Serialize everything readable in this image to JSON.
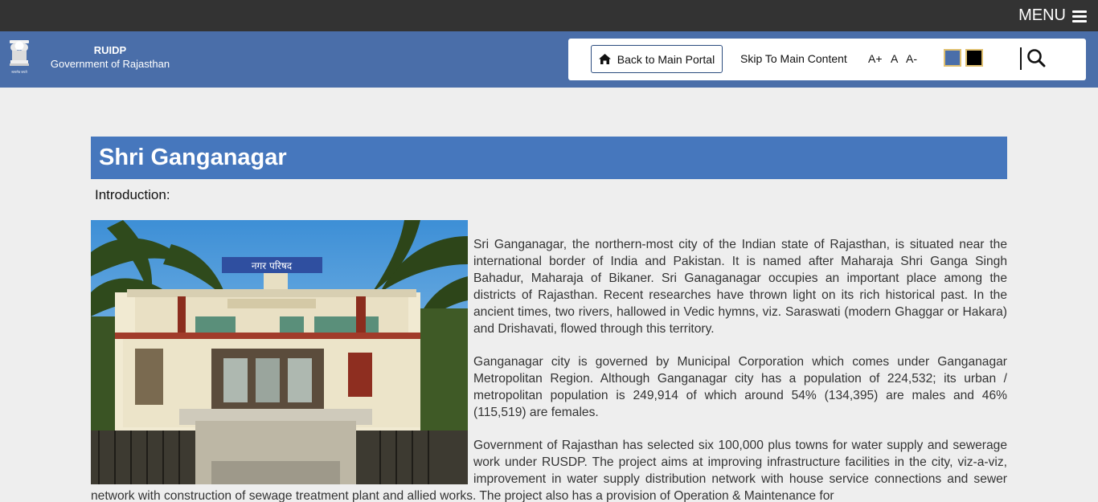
{
  "topbar": {
    "menu_label": "MENU"
  },
  "header": {
    "brand_name": "RUIDP",
    "brand_subtitle": "Government of Rajasthan",
    "emblem_text": "सत्यमेव जयते"
  },
  "toolbar": {
    "back_label": "Back to Main Portal",
    "skip_label": "Skip To Main Content",
    "font_increase": "A+",
    "font_normal": "A",
    "font_decrease": "A-"
  },
  "colors": {
    "header_blue": "#4a6ea9",
    "title_blue": "#4677bd",
    "topbar": "#333333"
  },
  "page": {
    "title": "Shri Ganganagar",
    "intro_heading": "Introduction:",
    "photo_sign_text": "नगर परिषद",
    "paragraphs": [
      "Sri Ganganagar, the northern-most city of the Indian state of Rajasthan, is situated near the international border of India and Pakistan. It is named after Maharaja Shri Ganga Singh Bahadur, Maharaja of Bikaner. Sri Ganaganagar occupies an important place among the districts of Rajasthan. Recent researches have thrown light on its rich historical past. In the ancient times, two rivers, hallowed in Vedic hymns, viz. Saraswati (modern Ghaggar or Hakara) and Drishavati, flowed through this territory.",
      "Ganganagar city is governed by Municipal Corporation which comes under Ganganagar Metropolitan Region. Although Ganganagar city has a population of 224,532; its urban / metropolitan population is 249,914 of which around 54% (134,395) are males and 46% (115,519) are females.",
      "Government of Rajasthan has selected six 100,000 plus towns for water supply and sewerage work under RUSDP. The project aims at improving infrastructure facilities in the city, viz-a-viz, improvement in water supply distribution network with house service connections and sewer network with construction of sewage treatment plant and allied works. The project also has a provision of Operation & Maintenance for"
    ]
  }
}
